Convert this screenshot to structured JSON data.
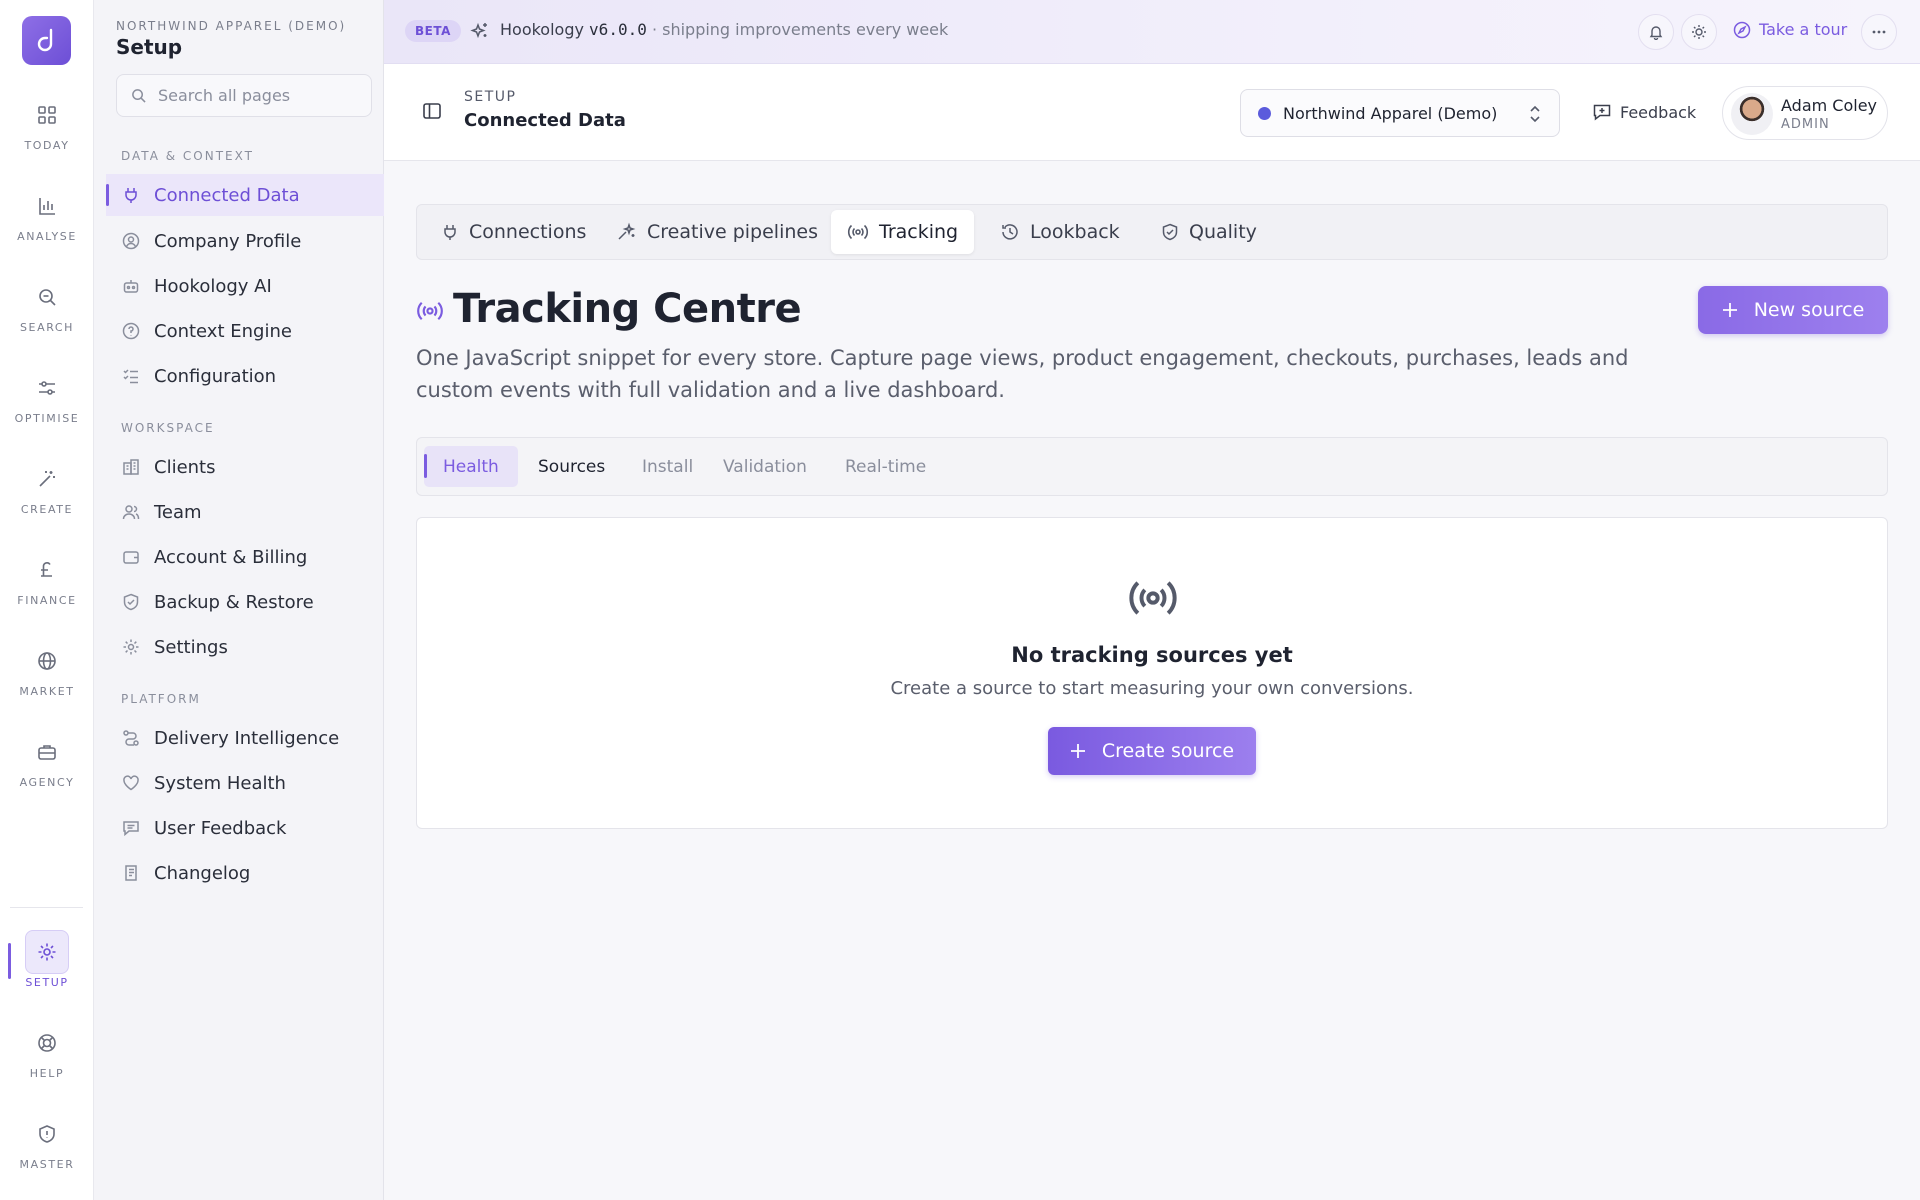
{
  "rail": {
    "logo_icon": "brand-logo-icon",
    "items": [
      {
        "label": "TODAY",
        "icon": "grid-icon"
      },
      {
        "label": "ANALYSE",
        "icon": "bar-chart-icon"
      },
      {
        "label": "SEARCH",
        "icon": "search-icon"
      },
      {
        "label": "OPTIMISE",
        "icon": "sliders-icon"
      },
      {
        "label": "CREATE",
        "icon": "magic-wand-icon"
      },
      {
        "label": "FINANCE",
        "icon": "pound-icon"
      },
      {
        "label": "MARKET",
        "icon": "globe-icon"
      },
      {
        "label": "AGENCY",
        "icon": "briefcase-icon"
      },
      {
        "label": "SETUP",
        "icon": "gear-icon",
        "active": true
      },
      {
        "label": "HELP",
        "icon": "lifebuoy-icon"
      },
      {
        "label": "MASTER",
        "icon": "shield-alert-icon"
      }
    ]
  },
  "sidebar": {
    "org": "NORTHWIND APPAREL (DEMO)",
    "title": "Setup",
    "search_placeholder": "Search all pages",
    "sections": [
      {
        "label": "DATA & CONTEXT",
        "items": [
          {
            "label": "Connected Data",
            "icon": "plug-icon",
            "active": true
          },
          {
            "label": "Company Profile",
            "icon": "user-circle-icon"
          },
          {
            "label": "Hookology AI",
            "icon": "bot-icon"
          },
          {
            "label": "Context Engine",
            "icon": "brain-icon"
          },
          {
            "label": "Configuration",
            "icon": "list-check-icon"
          }
        ]
      },
      {
        "label": "WORKSPACE",
        "items": [
          {
            "label": "Clients",
            "icon": "building-icon"
          },
          {
            "label": "Team",
            "icon": "users-icon"
          },
          {
            "label": "Account & Billing",
            "icon": "wallet-icon"
          },
          {
            "label": "Backup & Restore",
            "icon": "shield-check-icon"
          },
          {
            "label": "Settings",
            "icon": "gear-icon"
          }
        ]
      },
      {
        "label": "PLATFORM",
        "items": [
          {
            "label": "Delivery Intelligence",
            "icon": "route-icon"
          },
          {
            "label": "System Health",
            "icon": "heart-icon"
          },
          {
            "label": "User Feedback",
            "icon": "message-icon"
          },
          {
            "label": "Changelog",
            "icon": "document-icon"
          }
        ]
      }
    ]
  },
  "banner": {
    "badge": "BETA",
    "product": "Hookology",
    "version": "v6.0.0",
    "tagline": "· shipping improvements every week",
    "tour_label": "Take a tour"
  },
  "header": {
    "eyebrow": "SETUP",
    "title": "Connected Data",
    "org_selected": "Northwind Apparel (Demo)",
    "feedback_label": "Feedback",
    "user_name": "Adam Coley",
    "user_role": "ADMIN"
  },
  "main": {
    "tabs": [
      {
        "label": "Connections",
        "icon": "plug-icon"
      },
      {
        "label": "Creative pipelines",
        "icon": "sparkle-icon"
      },
      {
        "label": "Tracking",
        "icon": "broadcast-icon",
        "active": true
      },
      {
        "label": "Lookback",
        "icon": "history-icon"
      },
      {
        "label": "Quality",
        "icon": "shield-check-icon"
      }
    ],
    "title": "Tracking Centre",
    "description": "One JavaScript snippet for every store. Capture page views, product engagement, checkouts, purchases, leads and custom events with full validation and a live dashboard.",
    "new_source_label": "New source",
    "sub_tabs": [
      {
        "label": "Health",
        "active": true
      },
      {
        "label": "Sources"
      },
      {
        "label": "Install"
      },
      {
        "label": "Validation"
      },
      {
        "label": "Real-time"
      }
    ],
    "empty": {
      "title": "No tracking sources yet",
      "description": "Create a source to start measuring your own conversions.",
      "button_label": "Create source"
    }
  },
  "colors": {
    "accent": "#7b5ce0",
    "accent_light": "#ebe6fa",
    "org_dot": "#5b5bdc"
  }
}
